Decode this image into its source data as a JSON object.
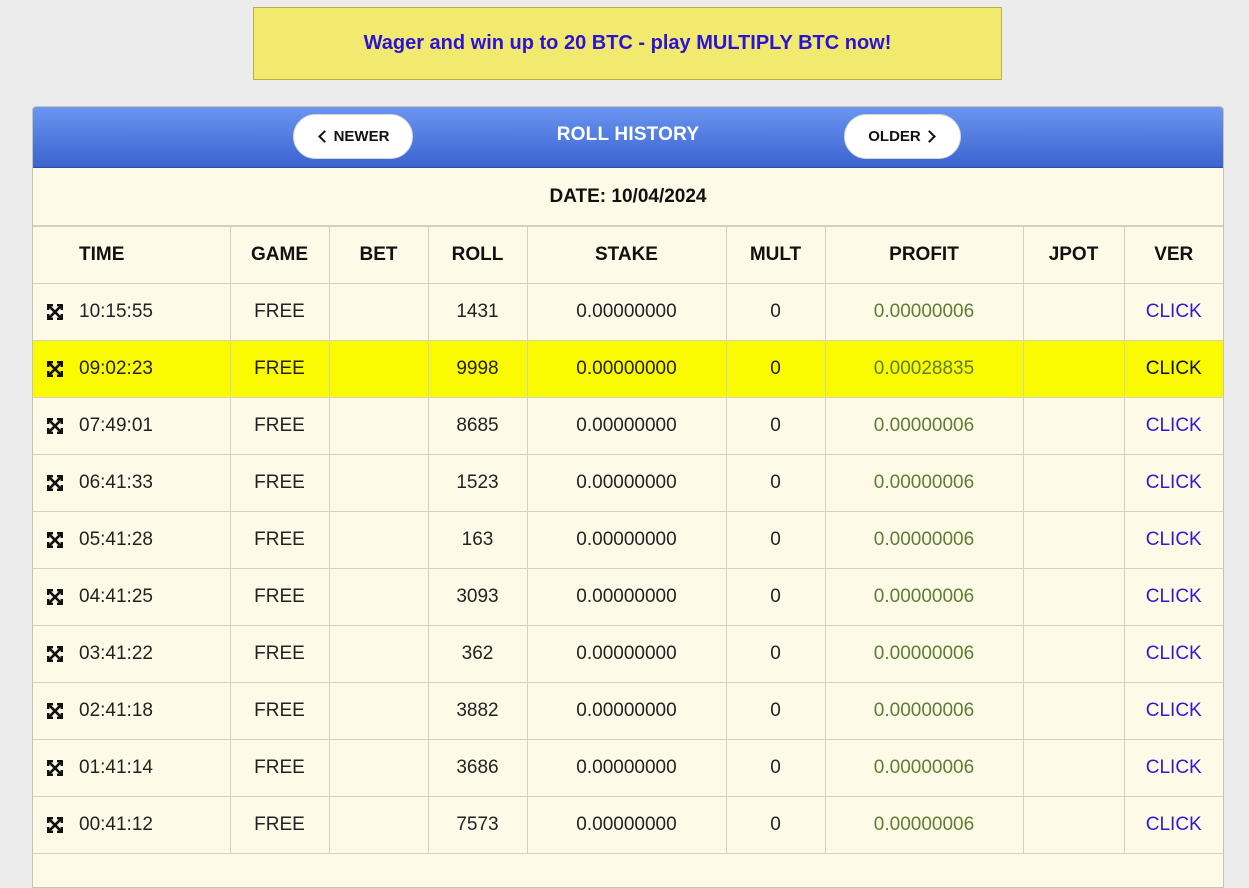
{
  "promo": {
    "text": "Wager and win up to 20 BTC - play MULTIPLY BTC now!"
  },
  "header": {
    "title": "ROLL HISTORY",
    "newer_label": "NEWER",
    "older_label": "OLDER"
  },
  "date_label": "DATE: 10/04/2024",
  "columns": [
    "TIME",
    "GAME",
    "BET",
    "ROLL",
    "STAKE",
    "MULT",
    "PROFIT",
    "JPOT",
    "VER"
  ],
  "highlight_color": "#fbfb00",
  "rows": [
    {
      "time": "10:15:55",
      "game": "FREE",
      "bet": "",
      "roll": "1431",
      "stake": "0.00000000",
      "mult": "0",
      "profit": "0.00000006",
      "jpot": "",
      "ver": "CLICK",
      "highlighted": false
    },
    {
      "time": "09:02:23",
      "game": "FREE",
      "bet": "",
      "roll": "9998",
      "stake": "0.00000000",
      "mult": "0",
      "profit": "0.00028835",
      "jpot": "",
      "ver": "CLICK",
      "highlighted": true
    },
    {
      "time": "07:49:01",
      "game": "FREE",
      "bet": "",
      "roll": "8685",
      "stake": "0.00000000",
      "mult": "0",
      "profit": "0.00000006",
      "jpot": "",
      "ver": "CLICK",
      "highlighted": false
    },
    {
      "time": "06:41:33",
      "game": "FREE",
      "bet": "",
      "roll": "1523",
      "stake": "0.00000000",
      "mult": "0",
      "profit": "0.00000006",
      "jpot": "",
      "ver": "CLICK",
      "highlighted": false
    },
    {
      "time": "05:41:28",
      "game": "FREE",
      "bet": "",
      "roll": "163",
      "stake": "0.00000000",
      "mult": "0",
      "profit": "0.00000006",
      "jpot": "",
      "ver": "CLICK",
      "highlighted": false
    },
    {
      "time": "04:41:25",
      "game": "FREE",
      "bet": "",
      "roll": "3093",
      "stake": "0.00000000",
      "mult": "0",
      "profit": "0.00000006",
      "jpot": "",
      "ver": "CLICK",
      "highlighted": false
    },
    {
      "time": "03:41:22",
      "game": "FREE",
      "bet": "",
      "roll": "362",
      "stake": "0.00000000",
      "mult": "0",
      "profit": "0.00000006",
      "jpot": "",
      "ver": "CLICK",
      "highlighted": false
    },
    {
      "time": "02:41:18",
      "game": "FREE",
      "bet": "",
      "roll": "3882",
      "stake": "0.00000000",
      "mult": "0",
      "profit": "0.00000006",
      "jpot": "",
      "ver": "CLICK",
      "highlighted": false
    },
    {
      "time": "01:41:14",
      "game": "FREE",
      "bet": "",
      "roll": "3686",
      "stake": "0.00000000",
      "mult": "0",
      "profit": "0.00000006",
      "jpot": "",
      "ver": "CLICK",
      "highlighted": false
    },
    {
      "time": "00:41:12",
      "game": "FREE",
      "bet": "",
      "roll": "7573",
      "stake": "0.00000000",
      "mult": "0",
      "profit": "0.00000006",
      "jpot": "",
      "ver": "CLICK",
      "highlighted": false
    }
  ]
}
